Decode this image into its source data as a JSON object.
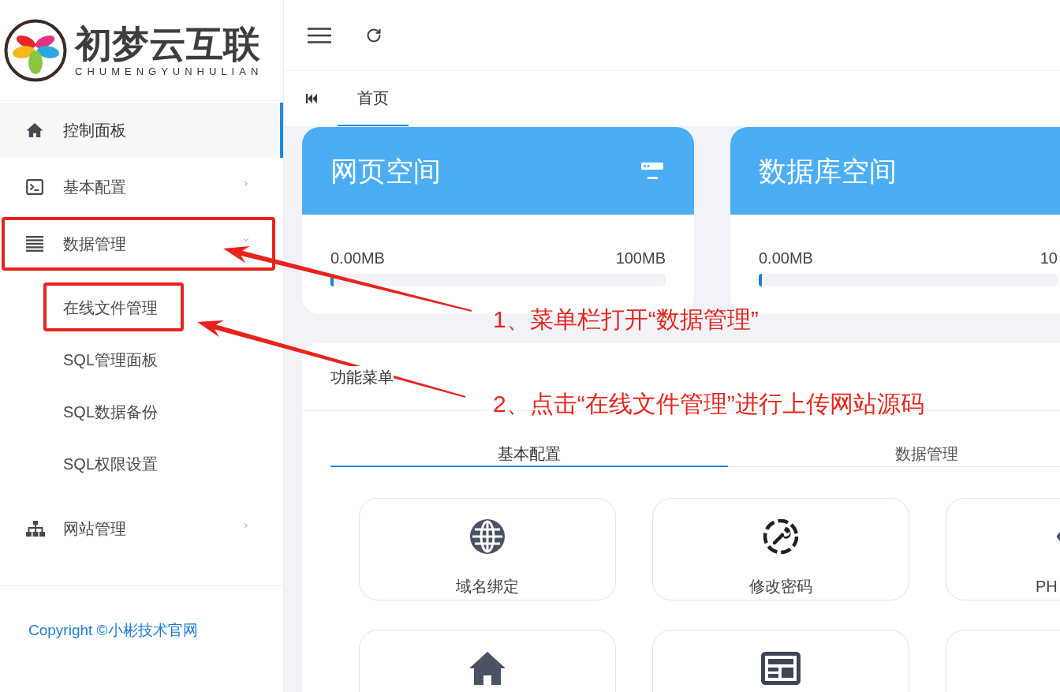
{
  "sidebar": {
    "logo": {
      "title": "初梦云互联",
      "subtitle": "CHUMENGYUNHULIAN"
    },
    "menu": [
      {
        "kind": "link",
        "label": "控制面板",
        "selected": true
      },
      {
        "kind": "group",
        "label": "基本配置",
        "selected": false,
        "expanded": false
      },
      {
        "kind": "group",
        "label": "数据管理",
        "selected": false,
        "expanded": true,
        "children": [
          {
            "label": "在线文件管理",
            "selected": false
          },
          {
            "label": "SQL管理面板",
            "selected": false
          },
          {
            "label": "SQL数据备份",
            "selected": false
          },
          {
            "label": "SQL权限设置",
            "selected": false
          }
        ]
      },
      {
        "kind": "group",
        "label": "网站管理",
        "selected": false,
        "expanded": false
      }
    ],
    "copyright": "Copyright ©小彬技术官网"
  },
  "page_tabs": [
    {
      "label": "首页",
      "selected": true
    }
  ],
  "storage_cards": [
    {
      "title": "网页空间",
      "header_icon": true,
      "used": "0.00MB",
      "total": "100MB",
      "level": 0.01
    },
    {
      "title": "数据库空间",
      "header_icon": false,
      "used": "0.00MB",
      "total": "10",
      "level": 0.01
    }
  ],
  "function_menu": {
    "title": "功能菜单",
    "tabs": [
      {
        "label": "基本配置",
        "selected": true
      },
      {
        "label": "数据管理",
        "selected": false
      }
    ],
    "tiles": [
      {
        "kind": "labeled",
        "label": "域名绑定"
      },
      {
        "kind": "labeled",
        "label": "修改密码"
      },
      {
        "kind": "labeled",
        "label": "PH"
      },
      {
        "kind": "cut"
      },
      {
        "kind": "cut"
      },
      {
        "kind": "cut"
      }
    ]
  },
  "annotations": [
    {
      "text": "1、菜单栏打开“数据管理”"
    },
    {
      "text": "2、点击“在线文件管理”进行上传网站源码"
    }
  ]
}
